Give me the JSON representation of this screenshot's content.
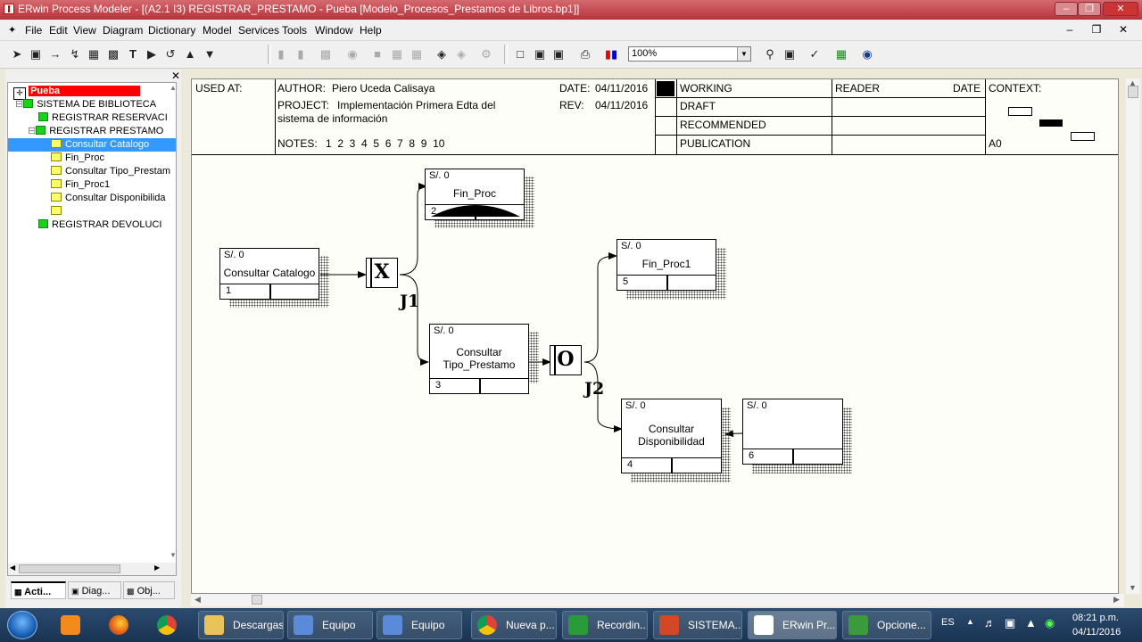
{
  "window": {
    "title": "ERwin Process Modeler - [(A2.1 I3) REGISTRAR_PRESTAMO - Pueba  [Modelo_Procesos_Prestamos de Libros.bp1]]"
  },
  "menu": {
    "items": [
      "File",
      "Edit",
      "View",
      "Diagram",
      "Dictionary",
      "Model",
      "Services",
      "Tools",
      "Window",
      "Help"
    ]
  },
  "toolbar": {
    "zoom_value": "100%"
  },
  "tree": {
    "root": "Pueba",
    "items": [
      {
        "label": "SISTEMA DE BIBLIOTECA"
      },
      {
        "label": "REGISTRAR RESERVACI"
      },
      {
        "label": "REGISTRAR PRESTAMO"
      },
      {
        "label": "Consultar Catalogo"
      },
      {
        "label": "Fin_Proc"
      },
      {
        "label": "Consultar  Tipo_Prestam"
      },
      {
        "label": "Fin_Proc1"
      },
      {
        "label": "Consultar   Disponibilida"
      },
      {
        "label": ""
      },
      {
        "label": "REGISTRAR  DEVOLUCI"
      }
    ],
    "tabs": [
      "Acti...",
      "Diag...",
      "Obj..."
    ]
  },
  "header": {
    "used_at": "USED AT:",
    "author_label": "AUTHOR:",
    "author": "Piero Uceda Calisaya",
    "project_label": "PROJECT:",
    "project_line1": "Implementación Primera Edta del",
    "project_line2": "sistema de información",
    "date_label": "DATE:",
    "date": "04/11/2016",
    "rev_label": "REV:",
    "rev": "04/11/2016",
    "notes_label": "NOTES:",
    "notes": "1  2  3  4  5  6  7  8  9  10",
    "status": [
      "WORKING",
      "DRAFT",
      "RECOMMENDED",
      "PUBLICATION"
    ],
    "reader": "READER",
    "reader_date": "DATE",
    "context": "CONTEXT:",
    "node": "A0"
  },
  "diagram": {
    "boxes": [
      {
        "cost": "S/. 0",
        "name": "Consultar Catalogo",
        "num": "1"
      },
      {
        "cost": "S/. 0",
        "name": "Fin_Proc",
        "num": "2"
      },
      {
        "cost": "S/. 0",
        "name": "Consultar Tipo_Prestamo",
        "num": "3"
      },
      {
        "cost": "S/. 0",
        "name": "Consultar Disponibilidad",
        "num": "4"
      },
      {
        "cost": "S/. 0",
        "name": "Fin_Proc1",
        "num": "5"
      },
      {
        "cost": "S/. 0",
        "name": "",
        "num": "6"
      }
    ],
    "junctions": [
      {
        "symbol": "X",
        "label": "J1"
      },
      {
        "symbol": "O",
        "label": "J2"
      }
    ]
  },
  "taskbar": {
    "items": [
      "Descargas",
      "Equipo",
      "Equipo",
      "Nueva p...",
      "Recordin...",
      "SISTEMA...",
      "ERwin Pr...",
      "Opcione..."
    ],
    "lang": "ES",
    "time": "08:21 p.m.",
    "date": "04/11/2016"
  }
}
